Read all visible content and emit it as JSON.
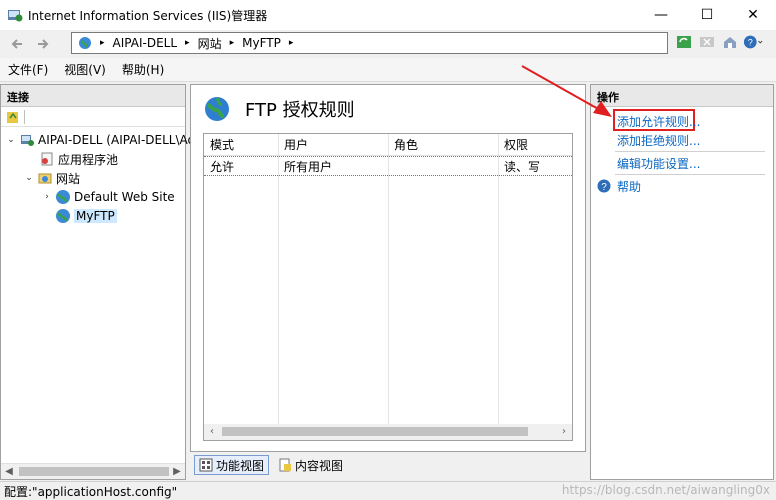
{
  "window": {
    "title": "Internet Information Services (IIS)管理器",
    "minimize": "—",
    "maximize": "☐",
    "close": "✕"
  },
  "address": {
    "crumbs": [
      "AIPAI-DELL",
      "网站",
      "MyFTP"
    ],
    "sep": "▸"
  },
  "menu": [
    "文件(F)",
    "视图(V)",
    "帮助(H)"
  ],
  "connections": {
    "header": "连接",
    "tree": {
      "server": "AIPAI-DELL (AIPAI-DELL\\Ad",
      "app_pools": "应用程序池",
      "sites": "网站",
      "default_site": "Default Web Site",
      "myftp": "MyFTP"
    }
  },
  "center": {
    "title": "FTP 授权规则",
    "columns": [
      "模式",
      "用户",
      "角色",
      "权限"
    ],
    "rows": [
      [
        "允许",
        "所有用户",
        "",
        "读、写"
      ]
    ],
    "tabs": [
      "功能视图",
      "内容视图"
    ]
  },
  "actions": {
    "header": "操作",
    "add_allow": "添加允许规则...",
    "add_deny": "添加拒绝规则...",
    "edit_settings": "编辑功能设置...",
    "help": "帮助"
  },
  "status": {
    "text": "配置:\"applicationHost.config\""
  },
  "watermark": "https://blog.csdn.net/aiwangling0x",
  "colors": {
    "link": "#0a66c2",
    "highlight": "#e02020",
    "selection": "#cde8ff"
  }
}
